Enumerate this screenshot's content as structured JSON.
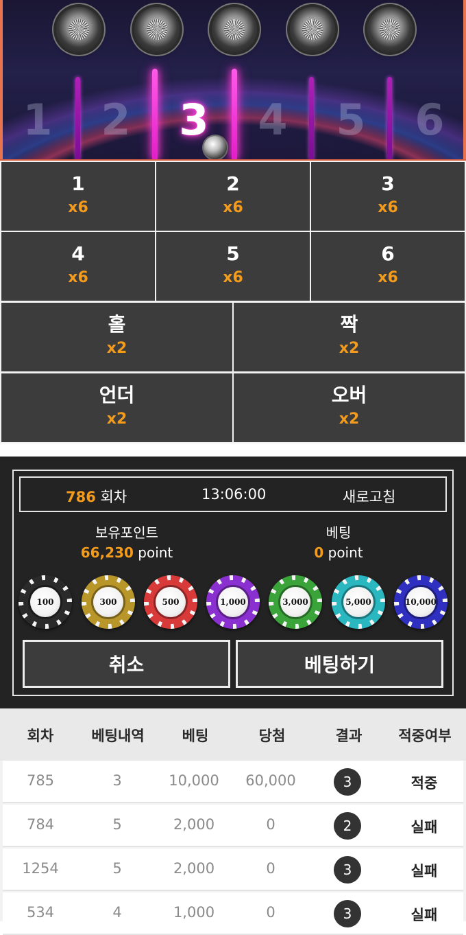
{
  "game": {
    "slot_numbers": [
      "1",
      "2",
      "3",
      "4",
      "5",
      "6"
    ],
    "active_slot": "3"
  },
  "bet_options": [
    {
      "label": "1",
      "odds": "x6"
    },
    {
      "label": "2",
      "odds": "x6"
    },
    {
      "label": "3",
      "odds": "x6"
    },
    {
      "label": "4",
      "odds": "x6"
    },
    {
      "label": "5",
      "odds": "x6"
    },
    {
      "label": "6",
      "odds": "x6"
    },
    {
      "label": "홀",
      "odds": "x2"
    },
    {
      "label": "짝",
      "odds": "x2"
    },
    {
      "label": "언더",
      "odds": "x2"
    },
    {
      "label": "오버",
      "odds": "x2"
    }
  ],
  "info": {
    "round_number": "786",
    "round_suffix": " 회차",
    "time": "13:06:00",
    "refresh_label": "새로고침"
  },
  "points": {
    "held_title": "보유포인트",
    "held_value": "66,230",
    "held_unit": " point",
    "bet_title": "베팅",
    "bet_value": "0",
    "bet_unit": " point"
  },
  "chips": [
    {
      "label": "100",
      "color": "#2a2a2a"
    },
    {
      "label": "300",
      "color": "#b8962a"
    },
    {
      "label": "500",
      "color": "#d83a3a"
    },
    {
      "label": "1,000",
      "color": "#8a2fd0"
    },
    {
      "label": "3,000",
      "color": "#3aa33a"
    },
    {
      "label": "5,000",
      "color": "#2ab7c0"
    },
    {
      "label": "10,000",
      "color": "#2f2fc0"
    }
  ],
  "buttons": {
    "cancel_label": "취소",
    "bet_label": "베팅하기"
  },
  "history": {
    "columns": [
      "회차",
      "베팅내역",
      "베팅",
      "당첨",
      "결과",
      "적중여부"
    ],
    "rows": [
      {
        "round": "785",
        "pick": "3",
        "bet": "10,000",
        "win": "60,000",
        "result": "3",
        "status": "적중"
      },
      {
        "round": "784",
        "pick": "5",
        "bet": "2,000",
        "win": "0",
        "result": "2",
        "status": "실패"
      },
      {
        "round": "1254",
        "pick": "5",
        "bet": "2,000",
        "win": "0",
        "result": "3",
        "status": "실패"
      },
      {
        "round": "534",
        "pick": "4",
        "bet": "1,000",
        "win": "0",
        "result": "3",
        "status": "실패"
      }
    ]
  },
  "colors": {
    "accent": "#f39b1c",
    "cell_bg": "#3c3c3c",
    "panel_bg": "#232323",
    "neon": "#ff3ad6"
  }
}
